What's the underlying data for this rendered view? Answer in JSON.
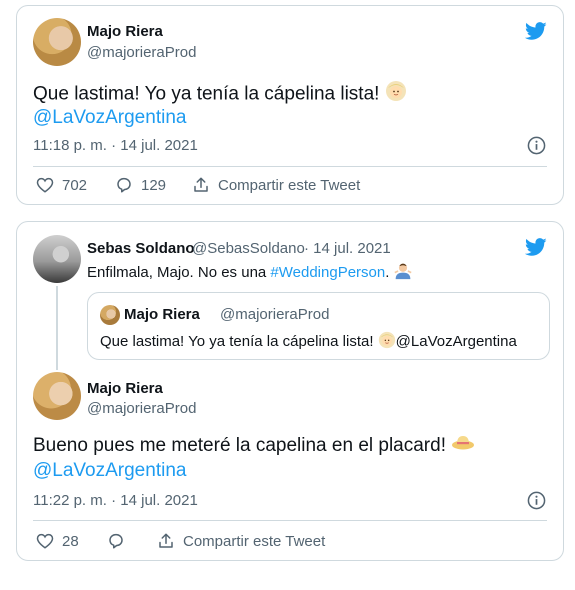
{
  "tweet1": {
    "author_name": "Majo Riera",
    "author_handle": "@majorieraProd",
    "text": "Que lastima! Yo ya tenía la cápelina lista! ",
    "mention": "@LaVozArgentina",
    "timestamp": "11:18 p. m. · 14 jul. 2021",
    "likes": "702",
    "replies": "129",
    "share_label": "Compartir este Tweet"
  },
  "tweet2": {
    "reply": {
      "author_name": "Sebas Soldano",
      "author_handle": "@SebasSoldano",
      "date": "· 14 jul. 2021",
      "text_before": "Enfilmala, Majo. No es una ",
      "hashtag": "#WeddingPerson",
      "text_after": ". "
    },
    "quote": {
      "author_name": "Majo Riera",
      "author_handle": "@majorieraProd",
      "text": "Que lastima! Yo ya tenía la cápelina lista! ",
      "mention": "@LaVozArgentina"
    },
    "main": {
      "author_name": "Majo Riera",
      "author_handle": "@majorieraProd",
      "text": "Bueno pues me meteré la capelina en el placard! ",
      "mention": "@LaVozArgentina",
      "timestamp": "11:22 p. m. · 14 jul. 2021",
      "likes": "28",
      "share_label": "Compartir este Tweet"
    }
  },
  "icons": [
    "twitter-bird-icon",
    "info-icon",
    "heart-icon",
    "reply-bubble-icon",
    "share-icon",
    "bride-emoji",
    "man-shrugging-emoji",
    "hat-emoji"
  ],
  "colors": {
    "link": "#1d9bf0",
    "twitter_blue": "#1d9bf0",
    "muted": "#536471",
    "border": "#cfd9de"
  }
}
